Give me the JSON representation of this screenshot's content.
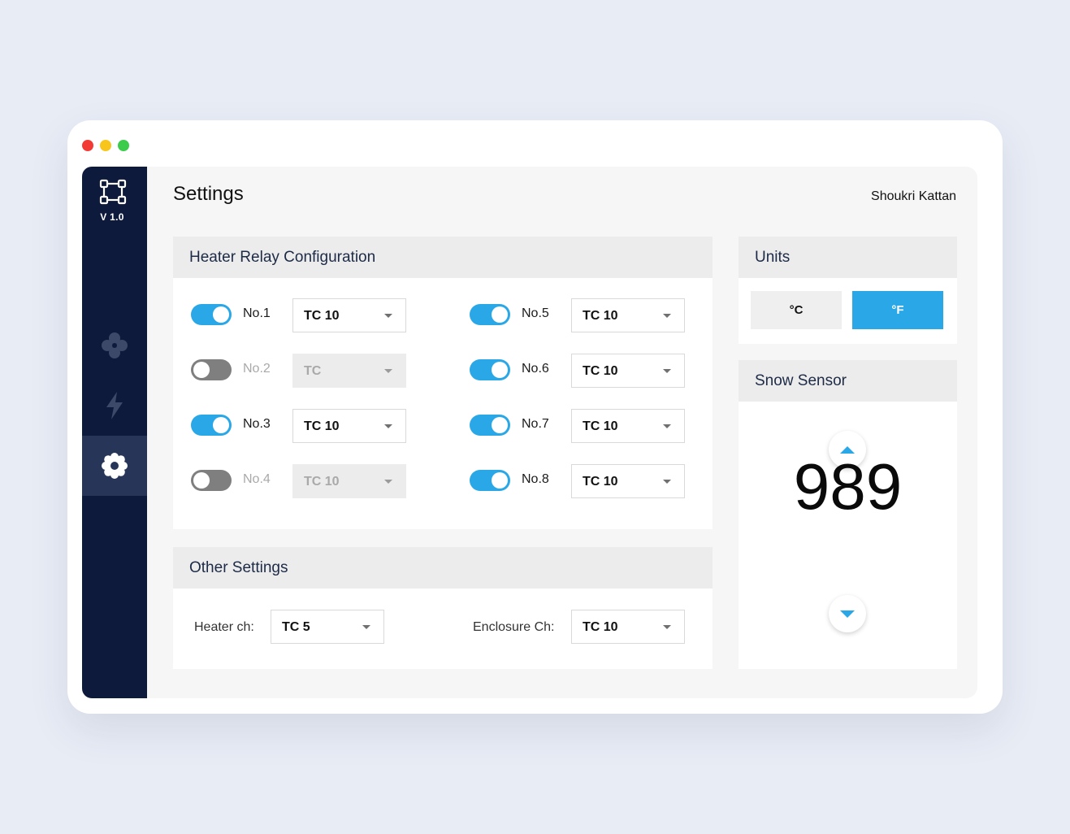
{
  "app": {
    "version": "V 1.0"
  },
  "sidebar": {
    "items": [
      {
        "icon": "fan-icon",
        "label": ""
      },
      {
        "icon": "lightning-icon",
        "label": ""
      },
      {
        "icon": "gear-icon",
        "label": ""
      }
    ],
    "active": "settings"
  },
  "header": {
    "title": "Settings",
    "user": "Shoukri Kattan"
  },
  "heater_relay": {
    "title": "Heater Relay Configuration",
    "relays": [
      {
        "label": "No.1",
        "enabled": true,
        "value": "TC 10"
      },
      {
        "label": "No.2",
        "enabled": false,
        "value": "TC"
      },
      {
        "label": "No.3",
        "enabled": true,
        "value": "TC 10"
      },
      {
        "label": "No.4",
        "enabled": false,
        "value": "TC 10"
      },
      {
        "label": "No.5",
        "enabled": true,
        "value": "TC 10"
      },
      {
        "label": "No.6",
        "enabled": true,
        "value": "TC 10"
      },
      {
        "label": "No.7",
        "enabled": true,
        "value": "TC 10"
      },
      {
        "label": "No.8",
        "enabled": true,
        "value": "TC 10"
      }
    ]
  },
  "other_settings": {
    "title": "Other Settings",
    "heater_label": "Heater ch:",
    "heater_value": "TC 5",
    "enclosure_label": "Enclosure Ch:",
    "enclosure_value": "TC 10"
  },
  "units": {
    "title": "Units",
    "celsius": "°C",
    "fahrenheit": "°F",
    "selected": "fahrenheit"
  },
  "snow_sensor": {
    "title": "Snow Sensor",
    "value": "989"
  },
  "colors": {
    "accent": "#2aa7e6",
    "sidebar": "#0d1a3b",
    "sidebar_active": "#273558"
  }
}
